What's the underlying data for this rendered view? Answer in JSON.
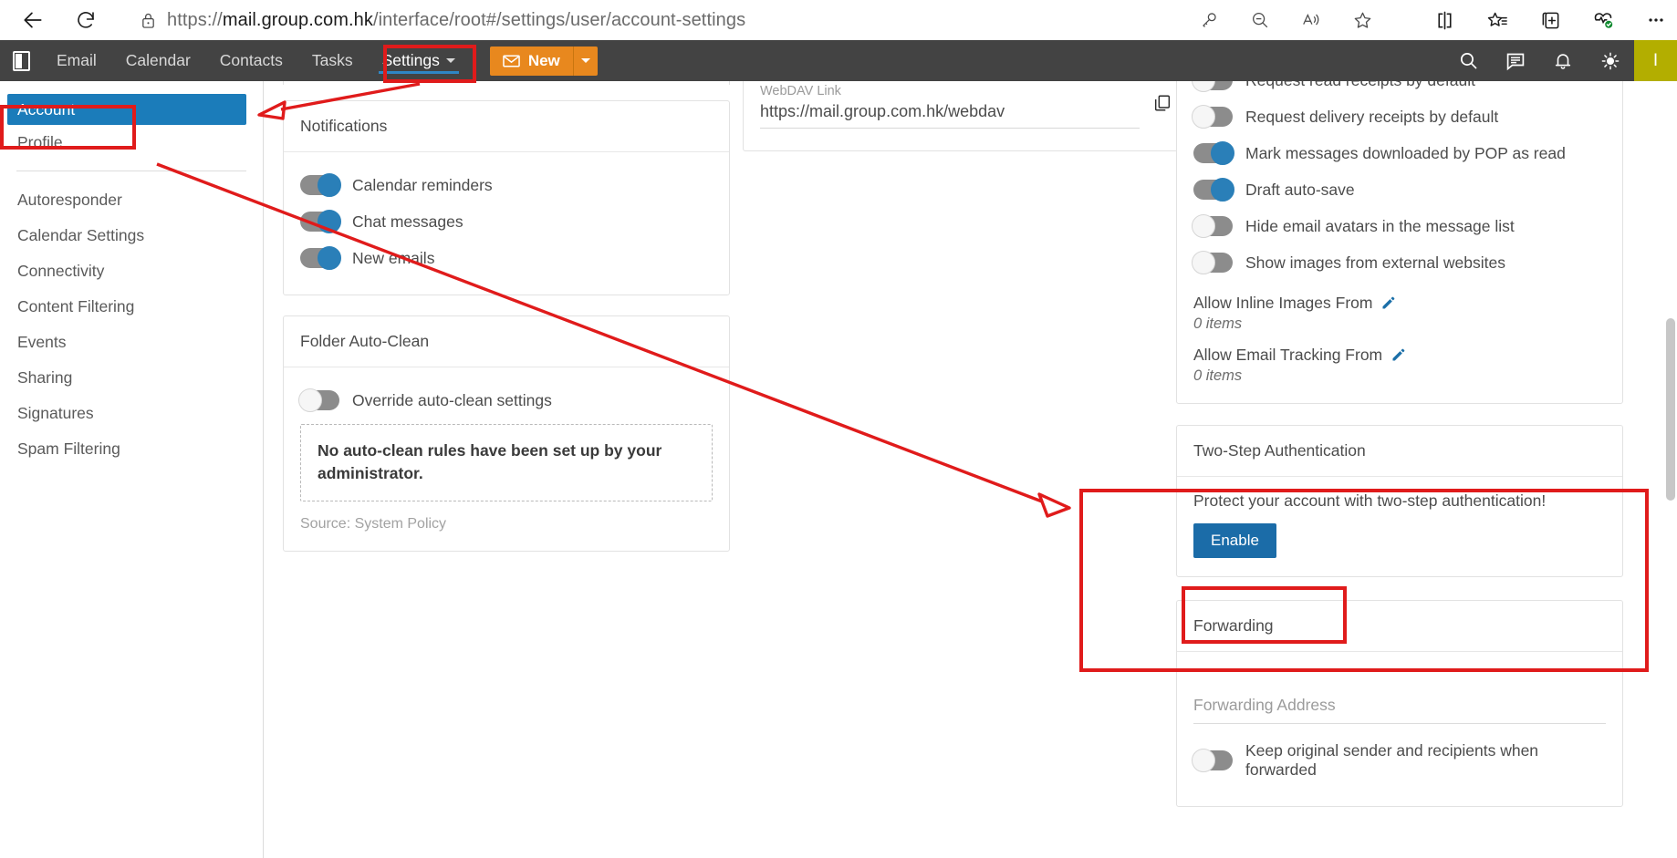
{
  "browser": {
    "url_prefix": "https://",
    "url_host": "mail.group.com.hk",
    "url_path": "/interface/root#/settings/user/account-settings",
    "icons": {
      "back": "back-arrow-icon",
      "reload": "reload-icon",
      "lock": "site-info-lock-icon",
      "key": "password-key-icon",
      "zoom_out": "zoom-out-icon",
      "read_aloud": "read-aloud-icon",
      "favorite": "add-favorite-star-icon",
      "split_screen": "split-screen-icon",
      "favorites_list": "favorites-star-list-icon",
      "collections": "collections-add-icon",
      "browser_essentials": "browser-essentials-icon",
      "settings_more": "more-options-icon"
    }
  },
  "appbar": {
    "panel_toggle": "panel-toggle-icon",
    "nav": [
      {
        "label": "Email",
        "active": false
      },
      {
        "label": "Calendar",
        "active": false
      },
      {
        "label": "Contacts",
        "active": false
      },
      {
        "label": "Tasks",
        "active": false
      },
      {
        "label": "Settings",
        "active": true
      }
    ],
    "new_button": {
      "label": "New",
      "icon": "envelope-icon"
    },
    "right_icons": [
      "search-icon",
      "chat-icon",
      "bell-icon",
      "theme-brightness-icon"
    ],
    "avatar_initial": "I"
  },
  "sidebar": {
    "primary": [
      {
        "label": "Account",
        "selected": true
      },
      {
        "label": "Profile",
        "selected": false
      }
    ],
    "secondary": [
      {
        "label": "Autoresponder"
      },
      {
        "label": "Calendar Settings"
      },
      {
        "label": "Connectivity"
      },
      {
        "label": "Content Filtering"
      },
      {
        "label": "Events"
      },
      {
        "label": "Sharing"
      },
      {
        "label": "Signatures"
      },
      {
        "label": "Spam Filtering"
      }
    ]
  },
  "column_one": {
    "notifications": {
      "title": "Notifications",
      "toggles": [
        {
          "label": "Calendar reminders",
          "on": true
        },
        {
          "label": "Chat messages",
          "on": true
        },
        {
          "label": "New emails",
          "on": true
        }
      ]
    },
    "folder_auto_clean": {
      "title": "Folder Auto-Clean",
      "override_toggle": {
        "label": "Override auto-clean settings",
        "on": false
      },
      "notice": "No auto-clean rules have been set up by your administrator.",
      "source": "Source: System Policy"
    }
  },
  "column_two": {
    "webdav": {
      "label": "WebDAV Link",
      "value": "https://mail.group.com.hk/webdav",
      "copy_icon": "copy-icon"
    }
  },
  "column_three": {
    "mail_options": {
      "toggles": [
        {
          "label": "Request read receipts by default",
          "on": false
        },
        {
          "label": "Request delivery receipts by default",
          "on": false
        },
        {
          "label": "Mark messages downloaded by POP as read",
          "on": true
        },
        {
          "label": "Draft auto-save",
          "on": true
        },
        {
          "label": "Hide email avatars in the message list",
          "on": false
        },
        {
          "label": "Show images from external websites",
          "on": false
        }
      ],
      "lists": [
        {
          "label": "Allow Inline Images From",
          "count": "0 items",
          "edit_icon": "pencil-edit-icon"
        },
        {
          "label": "Allow Email Tracking From",
          "count": "0 items",
          "edit_icon": "pencil-edit-icon"
        }
      ]
    },
    "two_step": {
      "title": "Two-Step Authentication",
      "description": "Protect your account with two-step authentication!",
      "enable_label": "Enable"
    },
    "forwarding": {
      "title": "Forwarding",
      "address_placeholder": "Forwarding Address",
      "address_value": "",
      "keep_original_toggle": {
        "label": "Keep original sender and recipients when forwarded",
        "on": false
      }
    }
  },
  "annotations": {
    "color": "#e01b1b",
    "boxes": [
      "settings-tab-highlight",
      "account-sidebar-highlight",
      "two-step-card-highlight",
      "enable-button-highlight"
    ],
    "arrows": [
      "settings-to-account-arrow",
      "profile-to-two-step-arrow"
    ]
  }
}
